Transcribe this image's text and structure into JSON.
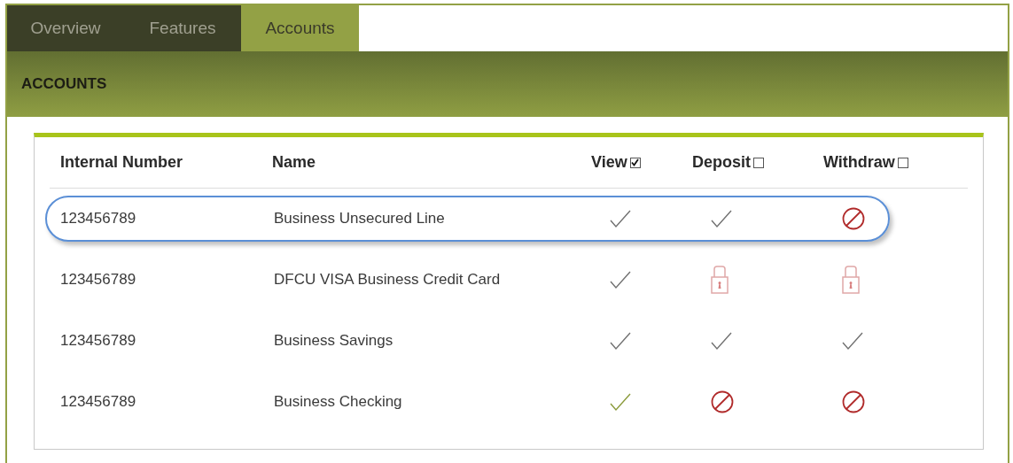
{
  "tabs": [
    {
      "label": "Overview",
      "selected": false
    },
    {
      "label": "Features",
      "selected": false
    },
    {
      "label": "Accounts",
      "selected": true
    }
  ],
  "section": {
    "title": "ACCOUNTS"
  },
  "table": {
    "columns": [
      {
        "label": "Internal Number",
        "kind": "text"
      },
      {
        "label": "Name",
        "kind": "text"
      },
      {
        "label": "View",
        "kind": "toggle",
        "checked": true
      },
      {
        "label": "Deposit",
        "kind": "toggle",
        "checked": false
      },
      {
        "label": "Withdraw",
        "kind": "toggle",
        "checked": false
      }
    ],
    "rows": [
      {
        "number": "123456789",
        "name": "Business Unsecured Line",
        "selected": true,
        "permissions": [
          {
            "kind": "allowed",
            "color": "#707070"
          },
          {
            "kind": "allowed",
            "color": "#707070"
          },
          {
            "kind": "denied"
          }
        ]
      },
      {
        "number": "123456789",
        "name": "DFCU VISA Business Credit Card",
        "selected": false,
        "permissions": [
          {
            "kind": "allowed",
            "color": "#707070"
          },
          {
            "kind": "locked"
          },
          {
            "kind": "locked"
          }
        ]
      },
      {
        "number": "123456789",
        "name": "Business Savings",
        "selected": false,
        "permissions": [
          {
            "kind": "allowed",
            "color": "#707070"
          },
          {
            "kind": "allowed",
            "color": "#707070"
          },
          {
            "kind": "allowed",
            "color": "#707070"
          }
        ]
      },
      {
        "number": "123456789",
        "name": "Business Checking",
        "selected": false,
        "permissions": [
          {
            "kind": "allowed",
            "color": "#8a9a3a"
          },
          {
            "kind": "denied"
          },
          {
            "kind": "denied"
          }
        ]
      }
    ]
  }
}
